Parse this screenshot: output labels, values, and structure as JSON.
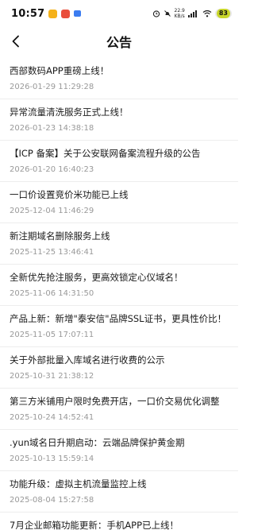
{
  "status_bar": {
    "time": "10:57",
    "speed_top": "22.9",
    "speed_bottom": "KB/s",
    "battery": "83",
    "colors": {
      "app1": "#f5b21a",
      "app2": "#e94e3c",
      "app3": "#3b7cf0",
      "battery": "#c8d62a"
    }
  },
  "nav": {
    "back_icon": "chevron-left-icon",
    "title": "公告"
  },
  "announcements": [
    {
      "title": "西部数码APP重磅上线！",
      "date": "2026-01-29 11:29:28"
    },
    {
      "title": "异常流量清洗服务正式上线！",
      "date": "2026-01-23 14:38:18"
    },
    {
      "title": "【ICP 备案】关于公安联网备案流程升级的公告",
      "date": "2026-01-20 16:40:23"
    },
    {
      "title": "一口价设置竞价米功能已上线",
      "date": "2025-12-04 11:46:29"
    },
    {
      "title": "新注期域名删除服务上线",
      "date": "2025-11-25 13:46:41"
    },
    {
      "title": "全新优先抢注服务，更高效锁定心仪域名！",
      "date": "2025-11-06 14:31:50"
    },
    {
      "title": "产品上新：新增\"泰安信\"品牌SSL证书，更具性价比！",
      "date": "2025-11-05 17:07:11"
    },
    {
      "title": "关于外部批量入库域名进行收费的公示",
      "date": "2025-10-31 21:38:12"
    },
    {
      "title": "第三方米铺用户限时免费开店，一口价交易优化调整",
      "date": "2025-10-24 14:52:41"
    },
    {
      "title": ".yun域名日升期启动：云端品牌保护黄金期",
      "date": "2025-10-13 15:59:14"
    },
    {
      "title": "功能升级：虚拟主机流量监控上线",
      "date": "2025-08-04 15:27:58"
    },
    {
      "title": "7月企业邮箱功能更新：手机APP已上线！",
      "date": ""
    }
  ]
}
